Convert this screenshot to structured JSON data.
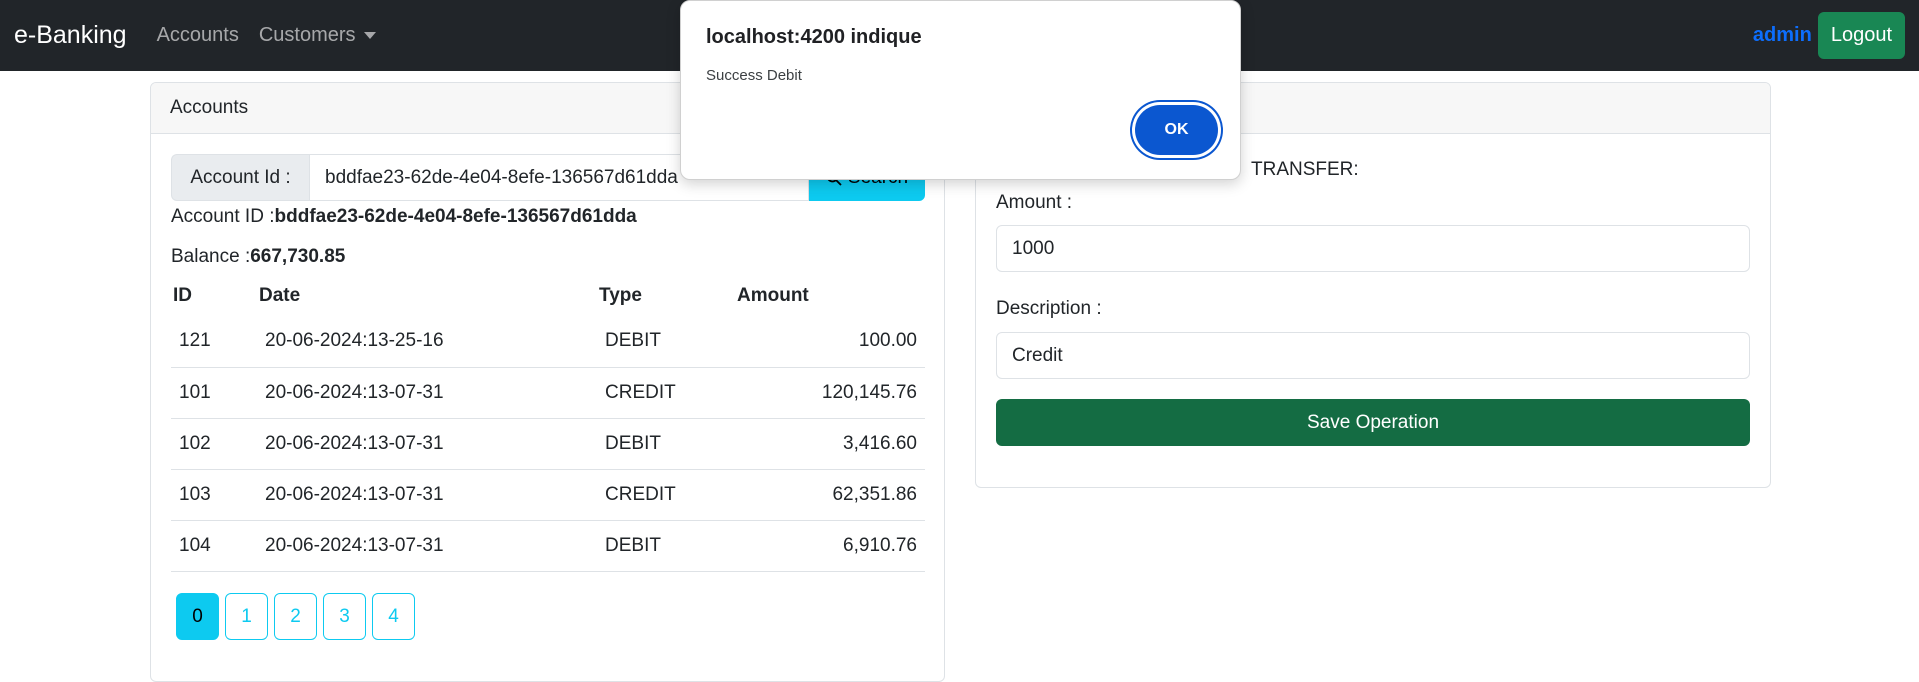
{
  "navbar": {
    "brand": "e-Banking",
    "links": [
      "Accounts",
      "Customers"
    ],
    "user": "admin",
    "logout_label": "Logout"
  },
  "accounts_card": {
    "title": "Accounts",
    "search": {
      "label": "Account Id :",
      "value": "bddfae23-62de-4e04-8efe-136567d61dda",
      "button_label": "Search"
    },
    "account_id_label": "Account ID :",
    "account_id_value": "bddfae23-62de-4e04-8efe-136567d61dda",
    "balance_label": "Balance :",
    "balance_value": "667,730.85",
    "table": {
      "headers": [
        "ID",
        "Date",
        "Type",
        "Amount"
      ],
      "rows": [
        [
          "121",
          "20-06-2024:13-25-16",
          "DEBIT",
          "100.00"
        ],
        [
          "101",
          "20-06-2024:13-07-31",
          "CREDIT",
          "120,145.76"
        ],
        [
          "102",
          "20-06-2024:13-07-31",
          "DEBIT",
          "3,416.60"
        ],
        [
          "103",
          "20-06-2024:13-07-31",
          "CREDIT",
          "62,351.86"
        ],
        [
          "104",
          "20-06-2024:13-07-31",
          "DEBIT",
          "6,910.76"
        ]
      ]
    },
    "pages": [
      "0",
      "1",
      "2",
      "3",
      "4"
    ],
    "active_page": "0"
  },
  "operations_card": {
    "transfer_label": "TRANSFER:",
    "amount_label": "Amount :",
    "amount_value": "1000",
    "description_label": "Description :",
    "description_value": "Credit",
    "save_label": "Save Operation"
  },
  "dialog": {
    "title": "localhost:4200 indique",
    "message": "Success Debit",
    "ok_label": "OK"
  },
  "colors": {
    "navbar_bg": "#212529",
    "admin": "#0d6efd",
    "logout": "#198754",
    "info": "#0dcaf0",
    "save": "#146c43",
    "dialog_ok": "#0b57d0"
  }
}
